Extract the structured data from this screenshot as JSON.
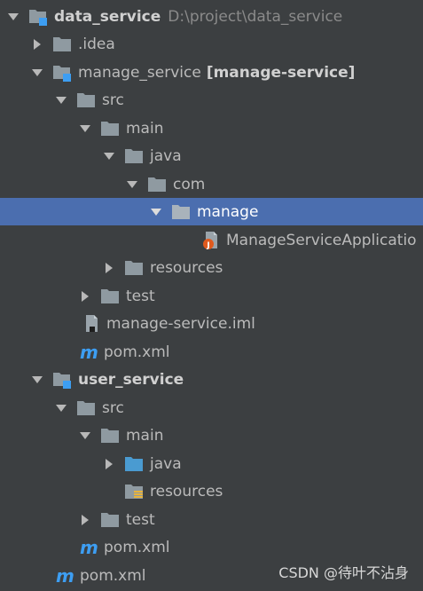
{
  "tree": {
    "root": {
      "name": "data_service",
      "path": "D:\\project\\data_service"
    },
    "idea": {
      "name": ".idea"
    },
    "manage_module": {
      "name": "manage_service",
      "module_label": "[manage-service]"
    },
    "manage_src": "src",
    "manage_main": "main",
    "manage_java": "java",
    "manage_com": "com",
    "manage_pkg": "manage",
    "manage_app_class": "ManageServiceApplicatio",
    "manage_resources": "resources",
    "manage_test": "test",
    "manage_iml": "manage-service.iml",
    "manage_pom": "pom.xml",
    "user_module": "user_service",
    "user_src": "src",
    "user_main": "main",
    "user_java": "java",
    "user_resources": "resources",
    "user_test": "test",
    "user_pom": "pom.xml",
    "root_pom": "pom.xml"
  },
  "watermark": "CSDN @待叶不沾身",
  "colors": {
    "background": "#3c3f41",
    "selection": "#4b6eaf",
    "folder": "#8f9aa1",
    "source_folder": "#4a9bd1",
    "module_badge": "#3d9ef2",
    "maven": "#3d9ef2"
  }
}
